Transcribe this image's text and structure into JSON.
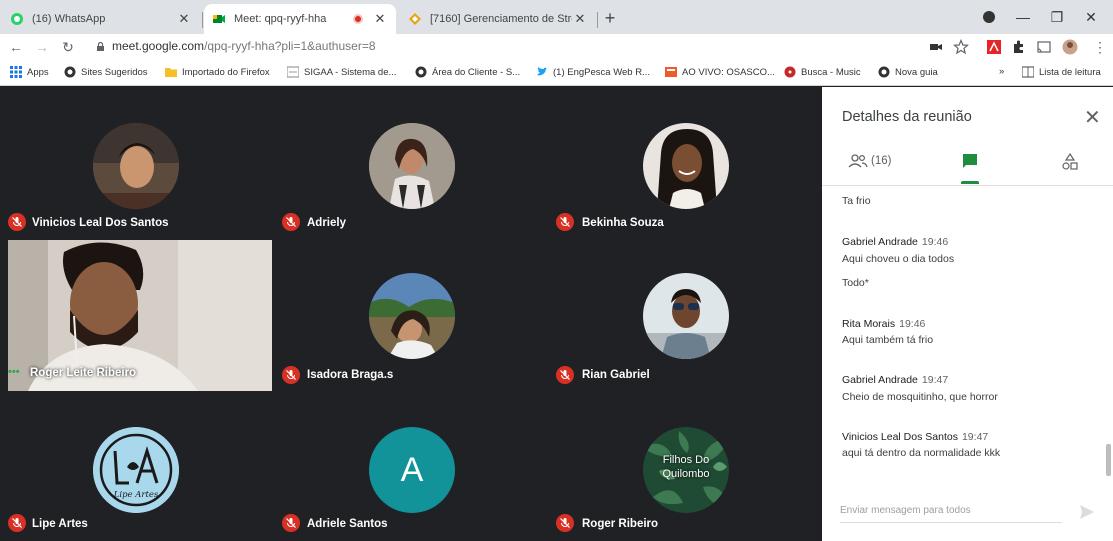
{
  "browser": {
    "tabs": [
      {
        "title": "(16) WhatsApp"
      },
      {
        "title": "Meet: qpq-ryyf-hha"
      },
      {
        "title": "[7160] Gerenciamento de Stream"
      }
    ],
    "url_host": "meet.google.com",
    "url_path": "/qpq-ryyf-hha?pli=1&authuser=8",
    "bookmarks": [
      "Apps",
      "Sites Sugeridos",
      "Importado do Firefox",
      "SIGAA - Sistema de...",
      "Área do Cliente - S...",
      "(1) EngPesca Web R...",
      "AO VIVO: OSASCO...",
      "Busca - Music",
      "Nova guia"
    ],
    "more_bookmarks": "»",
    "reading_list": "Lista de leitura"
  },
  "meet": {
    "participants": [
      {
        "name": "Vinicios Leal Dos Santos"
      },
      {
        "name": "Adriely"
      },
      {
        "name": "Bekinha Souza"
      },
      {
        "name": "Roger Leite Ribeiro"
      },
      {
        "name": "Isadora Braga.s"
      },
      {
        "name": "Rian Gabriel"
      },
      {
        "name": "Lipe Artes",
        "logo_text": "Lipe Artes"
      },
      {
        "name": "Adriele Santos",
        "initial": "A"
      },
      {
        "name": "Roger Ribeiro",
        "avatar_text": "Filhos Do Quilombo"
      }
    ]
  },
  "panel": {
    "title": "Detalhes da reunião",
    "people_count": "(16)",
    "messages": [
      {
        "text": "Ta frio"
      },
      {
        "sender": "Gabriel Andrade",
        "time": "19:46",
        "text": "Aqui choveu o dia todos"
      },
      {
        "text": "Todo*"
      },
      {
        "sender": "Rita Morais",
        "time": "19:46",
        "text": "Aqui também tá frio"
      },
      {
        "sender": "Gabriel Andrade",
        "time": "19:47",
        "text": "Cheio de mosquitinho, que horror"
      },
      {
        "sender": "Vinicios Leal Dos Santos",
        "time": "19:47",
        "text": "aqui tá dentro da normalidade kkk"
      }
    ],
    "compose_placeholder": "Enviar mensagem para todos"
  },
  "colors": {
    "meet_background": "#202124",
    "mute_red": "#d93025",
    "meet_green": "#1e8e3e",
    "avatar_teal": "#12939a"
  }
}
